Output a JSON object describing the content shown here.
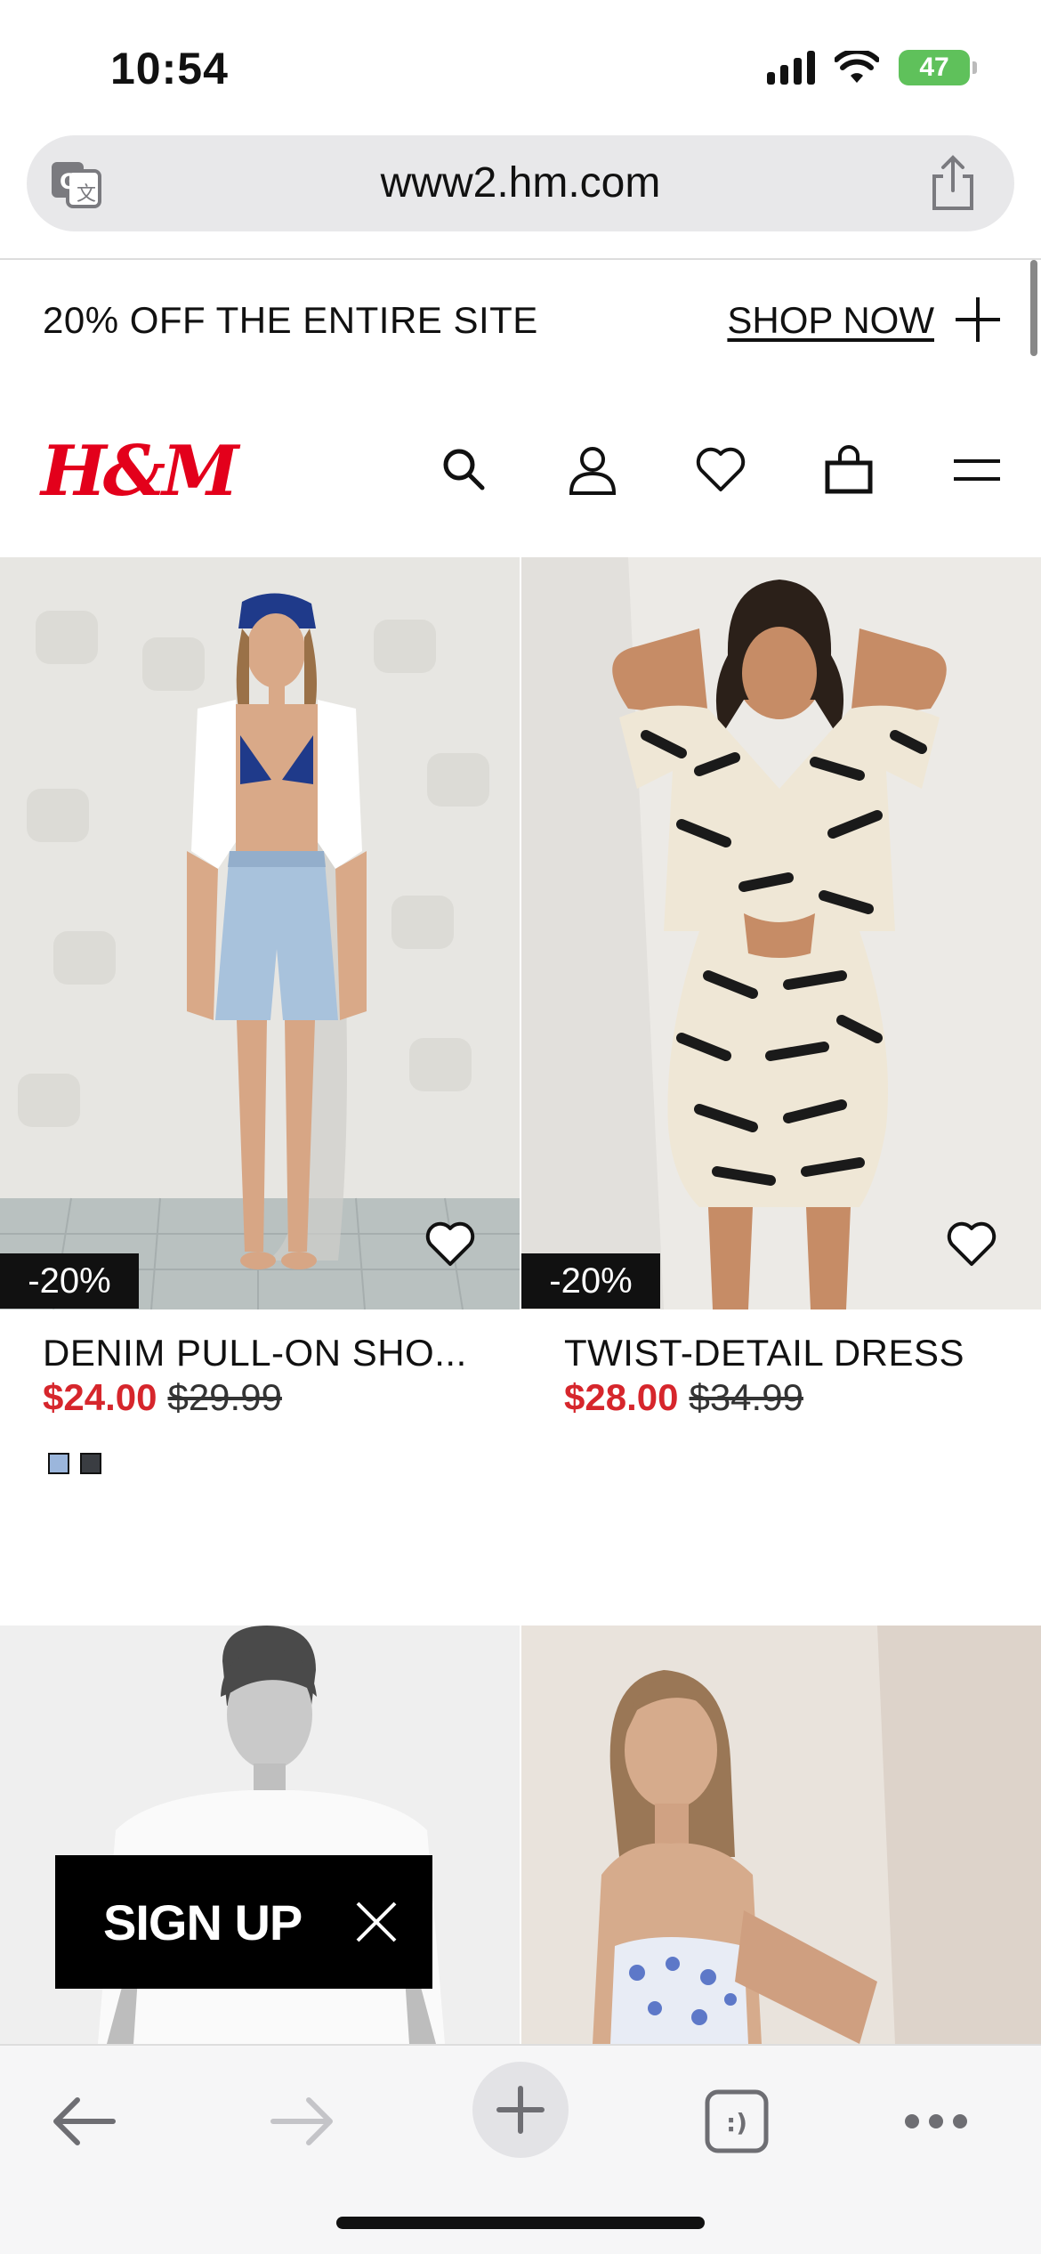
{
  "status_bar": {
    "time": "10:54",
    "battery": "47"
  },
  "browser": {
    "url": "www2.hm.com"
  },
  "promo": {
    "text": "20% OFF THE ENTIRE SITE",
    "link_label": "SHOP NOW"
  },
  "header": {
    "logo": "H&M",
    "icons": [
      "search-icon",
      "account-icon",
      "favorites-icon",
      "bag-icon",
      "menu-icon"
    ]
  },
  "products": [
    {
      "discount": "-20%",
      "name": "DENIM PULL-ON SHO...",
      "sale_price": "$24.00",
      "original_price": "$29.99",
      "swatches": [
        "#9bb6dc",
        "#3a3d42"
      ]
    },
    {
      "discount": "-20%",
      "name": "TWIST-DETAIL DRESS",
      "sale_price": "$28.00",
      "original_price": "$34.99",
      "swatches": []
    }
  ],
  "signup": {
    "label": "SIGN UP"
  },
  "colors": {
    "sale_red": "#d6262c",
    "brand_red": "#e3001b",
    "battery_green": "#5fc15b"
  },
  "toolbar": {
    "tab_icon_label": ":)"
  }
}
